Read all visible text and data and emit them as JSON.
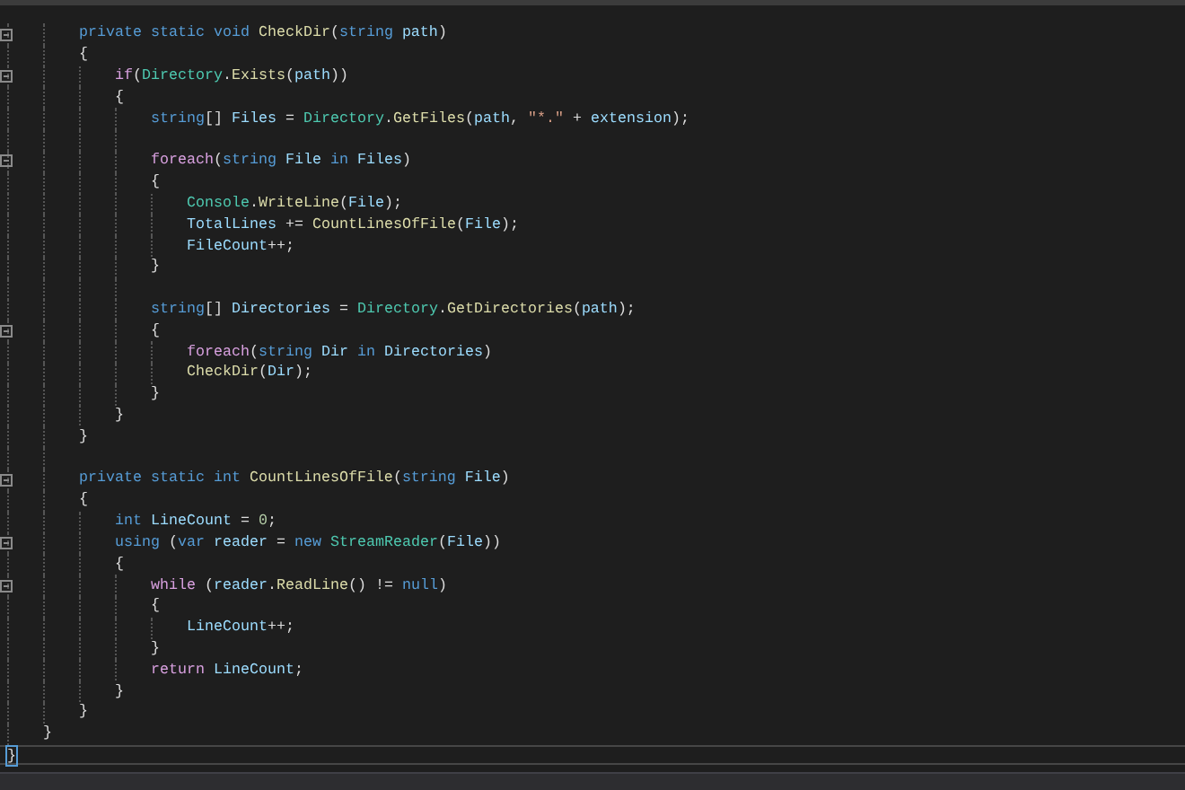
{
  "editor": {
    "lines": [
      {
        "kind": "group",
        "children": [
          {
            "kind": "group",
            "children": [
              {
                "kind": "code",
                "fold": {
                  "expanded": true
                },
                "tokens": [
                  {
                    "text": "private ",
                    "kind": "keyword"
                  },
                  {
                    "text": "static ",
                    "kind": "keyword"
                  },
                  {
                    "text": "void ",
                    "kind": "keyword"
                  },
                  {
                    "text": "CheckDir",
                    "kind": "method"
                  },
                  {
                    "text": "(",
                    "kind": "plain"
                  },
                  {
                    "text": "string ",
                    "kind": "keyword"
                  },
                  {
                    "text": "path",
                    "kind": "variable"
                  },
                  {
                    "text": ")",
                    "kind": "plain"
                  }
                ]
              },
              {
                "kind": "code",
                "tokens": [
                  {
                    "text": "{",
                    "kind": "plain"
                  }
                ],
                "children": [
                  {
                    "kind": "code",
                    "fold": {
                      "expanded": true
                    },
                    "tokens": [
                      {
                        "text": "if",
                        "kind": "control"
                      },
                      {
                        "text": "(",
                        "kind": "plain"
                      },
                      {
                        "text": "Directory",
                        "kind": "type"
                      },
                      {
                        "text": ".",
                        "kind": "plain"
                      },
                      {
                        "text": "Exists",
                        "kind": "method"
                      },
                      {
                        "text": "(",
                        "kind": "plain"
                      },
                      {
                        "text": "path",
                        "kind": "variable"
                      },
                      {
                        "text": "))",
                        "kind": "plain"
                      }
                    ]
                  },
                  {
                    "kind": "code",
                    "tokens": [
                      {
                        "text": "{",
                        "kind": "plain"
                      }
                    ],
                    "children": [
                      {
                        "kind": "code",
                        "tokens": [
                          {
                            "text": "string",
                            "kind": "keyword"
                          },
                          {
                            "text": "[] ",
                            "kind": "plain"
                          },
                          {
                            "text": "Files",
                            "kind": "variable"
                          },
                          {
                            "text": " = ",
                            "kind": "plain"
                          },
                          {
                            "text": "Directory",
                            "kind": "type"
                          },
                          {
                            "text": ".",
                            "kind": "plain"
                          },
                          {
                            "text": "GetFiles",
                            "kind": "method"
                          },
                          {
                            "text": "(",
                            "kind": "plain"
                          },
                          {
                            "text": "path",
                            "kind": "variable"
                          },
                          {
                            "text": ", ",
                            "kind": "plain"
                          },
                          {
                            "text": "\"*.\"",
                            "kind": "string"
                          },
                          {
                            "text": " + ",
                            "kind": "plain"
                          },
                          {
                            "text": "extension",
                            "kind": "variable"
                          },
                          {
                            "text": ");",
                            "kind": "plain"
                          }
                        ]
                      },
                      {
                        "kind": "blank"
                      },
                      {
                        "kind": "code",
                        "fold": {
                          "expanded": true
                        },
                        "tokens": [
                          {
                            "text": "foreach",
                            "kind": "control"
                          },
                          {
                            "text": "(",
                            "kind": "plain"
                          },
                          {
                            "text": "string ",
                            "kind": "keyword"
                          },
                          {
                            "text": "File ",
                            "kind": "variable"
                          },
                          {
                            "text": "in ",
                            "kind": "keyword"
                          },
                          {
                            "text": "Files",
                            "kind": "variable"
                          },
                          {
                            "text": ")",
                            "kind": "plain"
                          }
                        ]
                      },
                      {
                        "kind": "code",
                        "tokens": [
                          {
                            "text": "{",
                            "kind": "plain"
                          }
                        ],
                        "children": [
                          {
                            "kind": "code",
                            "tokens": [
                              {
                                "text": "Console",
                                "kind": "type"
                              },
                              {
                                "text": ".",
                                "kind": "plain"
                              },
                              {
                                "text": "WriteLine",
                                "kind": "method"
                              },
                              {
                                "text": "(",
                                "kind": "plain"
                              },
                              {
                                "text": "File",
                                "kind": "variable"
                              },
                              {
                                "text": ");",
                                "kind": "plain"
                              }
                            ]
                          },
                          {
                            "kind": "code",
                            "tokens": [
                              {
                                "text": "TotalLines",
                                "kind": "variable"
                              },
                              {
                                "text": " += ",
                                "kind": "plain"
                              },
                              {
                                "text": "CountLinesOfFile",
                                "kind": "method"
                              },
                              {
                                "text": "(",
                                "kind": "plain"
                              },
                              {
                                "text": "File",
                                "kind": "variable"
                              },
                              {
                                "text": ");",
                                "kind": "plain"
                              }
                            ]
                          },
                          {
                            "kind": "code",
                            "tokens": [
                              {
                                "text": "FileCount",
                                "kind": "variable"
                              },
                              {
                                "text": "++;",
                                "kind": "plain"
                              }
                            ]
                          }
                        ]
                      },
                      {
                        "kind": "code",
                        "tokens": [
                          {
                            "text": "}",
                            "kind": "plain"
                          }
                        ]
                      },
                      {
                        "kind": "blank"
                      },
                      {
                        "kind": "code",
                        "tokens": [
                          {
                            "text": "string",
                            "kind": "keyword"
                          },
                          {
                            "text": "[] ",
                            "kind": "plain"
                          },
                          {
                            "text": "Directories",
                            "kind": "variable"
                          },
                          {
                            "text": " = ",
                            "kind": "plain"
                          },
                          {
                            "text": "Directory",
                            "kind": "type"
                          },
                          {
                            "text": ".",
                            "kind": "plain"
                          },
                          {
                            "text": "GetDirectories",
                            "kind": "method"
                          },
                          {
                            "text": "(",
                            "kind": "plain"
                          },
                          {
                            "text": "path",
                            "kind": "variable"
                          },
                          {
                            "text": ");",
                            "kind": "plain"
                          }
                        ]
                      },
                      {
                        "kind": "code",
                        "fold": {
                          "expanded": true
                        },
                        "tokens": [
                          {
                            "text": "{",
                            "kind": "plain"
                          }
                        ],
                        "children": [
                          {
                            "kind": "code",
                            "tokens": [
                              {
                                "text": "foreach",
                                "kind": "control"
                              },
                              {
                                "text": "(",
                                "kind": "plain"
                              },
                              {
                                "text": "string ",
                                "kind": "keyword"
                              },
                              {
                                "text": "Dir ",
                                "kind": "variable"
                              },
                              {
                                "text": "in ",
                                "kind": "keyword"
                              },
                              {
                                "text": "Directories",
                                "kind": "variable"
                              },
                              {
                                "text": ")",
                                "kind": "plain"
                              }
                            ]
                          },
                          {
                            "kind": "code",
                            "tokens": [
                              {
                                "text": "CheckDir",
                                "kind": "method"
                              },
                              {
                                "text": "(",
                                "kind": "plain"
                              },
                              {
                                "text": "Dir",
                                "kind": "variable"
                              },
                              {
                                "text": ");",
                                "kind": "plain"
                              }
                            ]
                          }
                        ]
                      },
                      {
                        "kind": "code",
                        "tokens": [
                          {
                            "text": "}",
                            "kind": "plain"
                          }
                        ]
                      }
                    ]
                  },
                  {
                    "kind": "code",
                    "tokens": [
                      {
                        "text": "}",
                        "kind": "plain"
                      }
                    ]
                  }
                ]
              },
              {
                "kind": "code",
                "tokens": [
                  {
                    "text": "}",
                    "kind": "plain"
                  }
                ]
              },
              {
                "kind": "blank"
              },
              {
                "kind": "code",
                "fold": {
                  "expanded": true
                },
                "tokens": [
                  {
                    "text": "private ",
                    "kind": "keyword"
                  },
                  {
                    "text": "static ",
                    "kind": "keyword"
                  },
                  {
                    "text": "int ",
                    "kind": "keyword"
                  },
                  {
                    "text": "CountLinesOfFile",
                    "kind": "method"
                  },
                  {
                    "text": "(",
                    "kind": "plain"
                  },
                  {
                    "text": "string ",
                    "kind": "keyword"
                  },
                  {
                    "text": "File",
                    "kind": "variable"
                  },
                  {
                    "text": ")",
                    "kind": "plain"
                  }
                ]
              },
              {
                "kind": "code",
                "tokens": [
                  {
                    "text": "{",
                    "kind": "plain"
                  }
                ],
                "children": [
                  {
                    "kind": "code",
                    "tokens": [
                      {
                        "text": "int ",
                        "kind": "keyword"
                      },
                      {
                        "text": "LineCount",
                        "kind": "variable"
                      },
                      {
                        "text": " = ",
                        "kind": "plain"
                      },
                      {
                        "text": "0",
                        "kind": "number"
                      },
                      {
                        "text": ";",
                        "kind": "plain"
                      }
                    ]
                  },
                  {
                    "kind": "code",
                    "fold": {
                      "expanded": true
                    },
                    "tokens": [
                      {
                        "text": "using",
                        "kind": "keyword"
                      },
                      {
                        "text": " (",
                        "kind": "plain"
                      },
                      {
                        "text": "var ",
                        "kind": "keyword"
                      },
                      {
                        "text": "reader",
                        "kind": "variable"
                      },
                      {
                        "text": " = ",
                        "kind": "plain"
                      },
                      {
                        "text": "new ",
                        "kind": "keyword"
                      },
                      {
                        "text": "StreamReader",
                        "kind": "type"
                      },
                      {
                        "text": "(",
                        "kind": "plain"
                      },
                      {
                        "text": "File",
                        "kind": "variable"
                      },
                      {
                        "text": "))",
                        "kind": "plain"
                      }
                    ]
                  },
                  {
                    "kind": "code",
                    "tokens": [
                      {
                        "text": "{",
                        "kind": "plain"
                      }
                    ],
                    "children": [
                      {
                        "kind": "code",
                        "fold": {
                          "expanded": true
                        },
                        "tokens": [
                          {
                            "text": "while",
                            "kind": "control"
                          },
                          {
                            "text": " (",
                            "kind": "plain"
                          },
                          {
                            "text": "reader",
                            "kind": "variable"
                          },
                          {
                            "text": ".",
                            "kind": "plain"
                          },
                          {
                            "text": "ReadLine",
                            "kind": "method"
                          },
                          {
                            "text": "() != ",
                            "kind": "plain"
                          },
                          {
                            "text": "null",
                            "kind": "keyword"
                          },
                          {
                            "text": ")",
                            "kind": "plain"
                          }
                        ]
                      },
                      {
                        "kind": "code",
                        "tokens": [
                          {
                            "text": "{",
                            "kind": "plain"
                          }
                        ],
                        "children": [
                          {
                            "kind": "code",
                            "tokens": [
                              {
                                "text": "LineCount",
                                "kind": "variable"
                              },
                              {
                                "text": "++;",
                                "kind": "plain"
                              }
                            ]
                          }
                        ]
                      },
                      {
                        "kind": "code",
                        "tokens": [
                          {
                            "text": "}",
                            "kind": "plain"
                          }
                        ]
                      },
                      {
                        "kind": "code",
                        "tokens": [
                          {
                            "text": "return ",
                            "kind": "control"
                          },
                          {
                            "text": "LineCount",
                            "kind": "variable"
                          },
                          {
                            "text": ";",
                            "kind": "plain"
                          }
                        ]
                      }
                    ]
                  },
                  {
                    "kind": "code",
                    "tokens": [
                      {
                        "text": "}",
                        "kind": "plain"
                      }
                    ]
                  }
                ]
              },
              {
                "kind": "code",
                "tokens": [
                  {
                    "text": "}",
                    "kind": "plain"
                  }
                ]
              }
            ]
          },
          {
            "kind": "code",
            "tokens": [
              {
                "text": "}",
                "kind": "plain"
              }
            ]
          }
        ]
      },
      {
        "kind": "code",
        "current": true,
        "tokens": [
          {
            "text": "}",
            "kind": "plain"
          }
        ]
      }
    ]
  }
}
